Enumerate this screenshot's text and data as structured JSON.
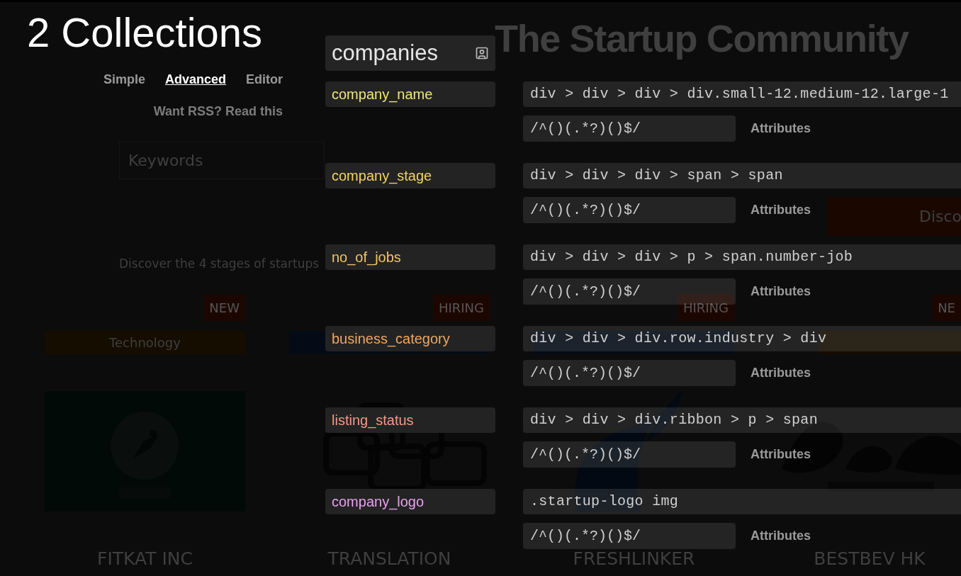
{
  "background_page": {
    "title": "The Startup Community",
    "keywords_placeholder": "Keywords",
    "discover_button": "Disco",
    "stages_link": "Discover the 4 stages of startups",
    "cards": [
      {
        "badge": "NEW",
        "category": "Technology",
        "name": "FITKAT INC"
      },
      {
        "badge": "HIRING",
        "name": "TRANSLATION"
      },
      {
        "badge": "HIRING",
        "name": "FRESHLINKER"
      },
      {
        "badge": "NE",
        "name": "BESTBEV HK"
      }
    ]
  },
  "panel": {
    "title": "2 Collections",
    "tabs": [
      {
        "label": "Simple",
        "selected": false
      },
      {
        "label": "Advanced",
        "selected": true
      },
      {
        "label": "Editor",
        "selected": false
      }
    ],
    "rss_link": "Want RSS? Read this"
  },
  "collection": {
    "name": "companies",
    "fields": [
      {
        "name": "company_name",
        "color": "#eee77a",
        "selector": "div > div > div > div.small-12.medium-12.large-1",
        "regex": "/^()(.*?)()$/",
        "attributes": "Attributes"
      },
      {
        "name": "company_stage",
        "color": "#f0d463",
        "selector": "div > div > div > span > span",
        "regex": "/^()(.*?)()$/",
        "attributes": "Attributes"
      },
      {
        "name": "no_of_jobs",
        "color": "#f3c466",
        "selector": "div > div > div > p > span.number-job",
        "regex": "/^()(.*?)()$/",
        "attributes": "Attributes"
      },
      {
        "name": "business_category",
        "color": "#f2a65e",
        "selector": "div > div > div.row.industry > div",
        "regex": "/^()(.*?)()$/",
        "attributes": "Attributes"
      },
      {
        "name": "listing_status",
        "color": "#f29a86",
        "selector": "div > div > div.ribbon > p > span",
        "regex": "/^()(.*?)()$/",
        "attributes": "Attributes"
      },
      {
        "name": "company_logo",
        "color": "#e7a2ee",
        "selector": ".startup-logo img",
        "regex": "/^()(.*?)()$/",
        "attributes": "Attributes"
      }
    ]
  }
}
